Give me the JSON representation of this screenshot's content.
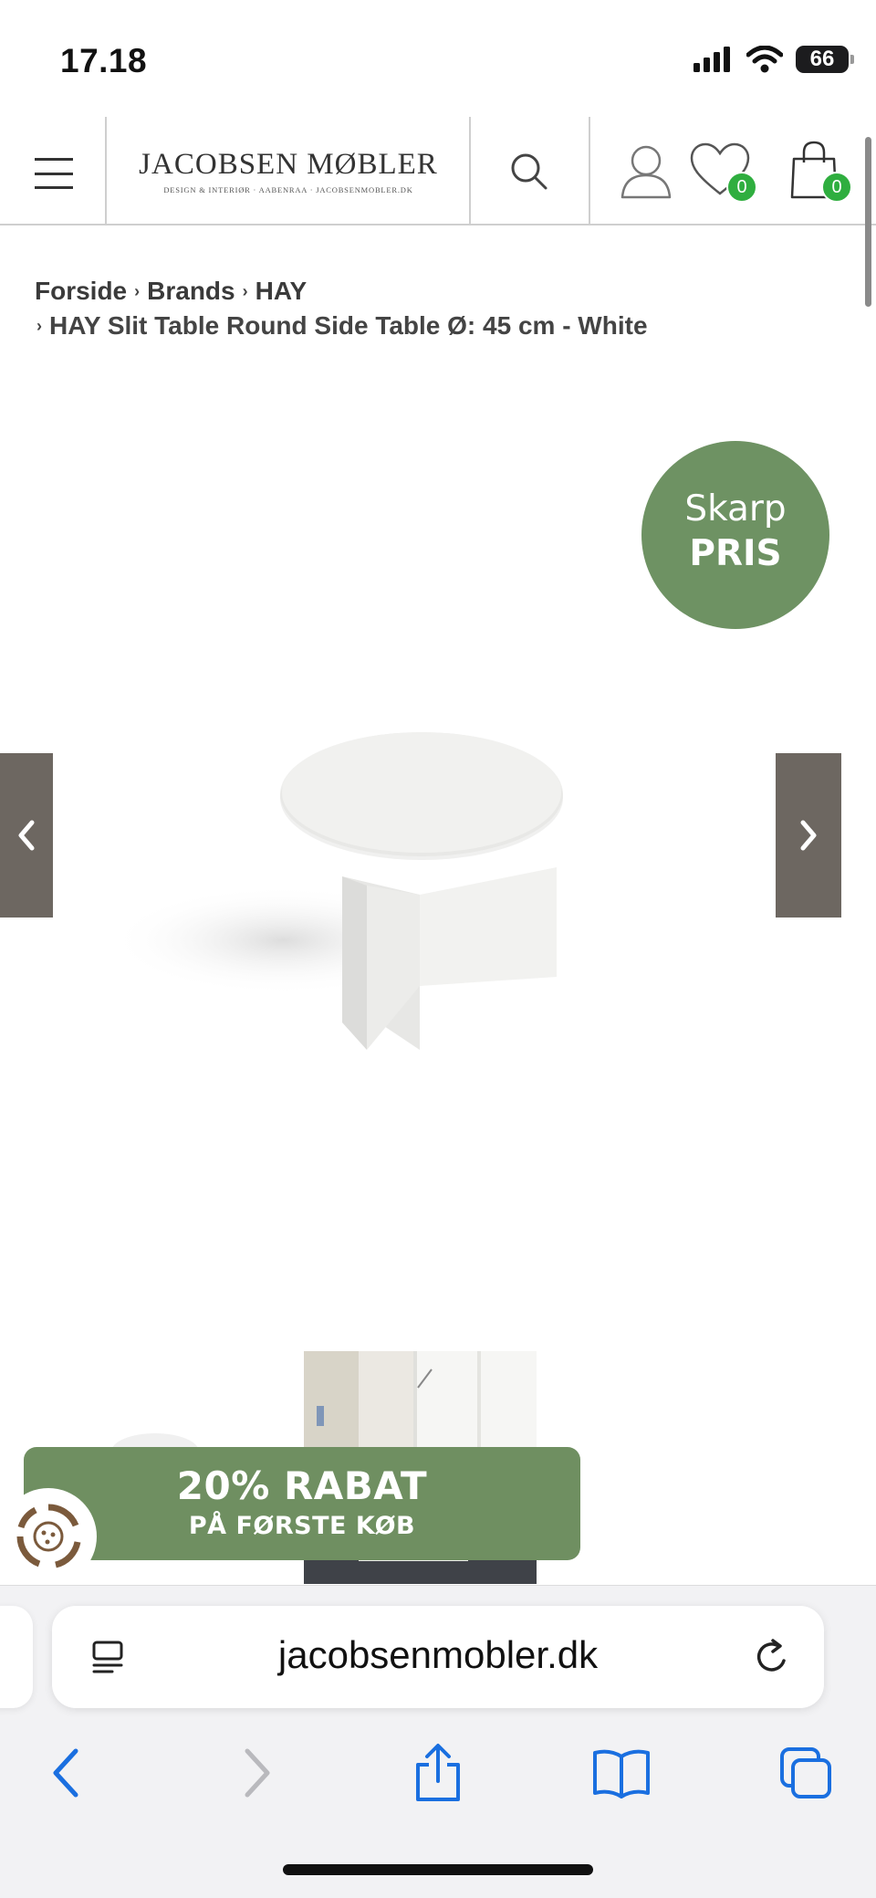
{
  "status_bar": {
    "time": "17.18",
    "battery": "66"
  },
  "header": {
    "logo_main": "JACOBSEN MØBLER",
    "logo_sub": "DESIGN & INTERIØR · AABENRAA · JACOBSENMOBLER.DK",
    "wishlist_count": "0",
    "cart_count": "0"
  },
  "breadcrumb": {
    "items": [
      "Forside",
      "Brands",
      "HAY"
    ],
    "current": "HAY Slit Table Round Side Table Ø: 45 cm - White"
  },
  "product": {
    "badge_line1": "Skarp",
    "badge_line2": "PRIS"
  },
  "promo": {
    "title": "20% RABAT",
    "subtitle": "PÅ FØRSTE KØB"
  },
  "browser": {
    "url": "jacobsenmobler.dk"
  },
  "colors": {
    "accent_green": "#6e9263",
    "badge_green": "#2fae3f",
    "arrow_bg": "#6d6761",
    "ios_blue": "#1a6fe0"
  }
}
